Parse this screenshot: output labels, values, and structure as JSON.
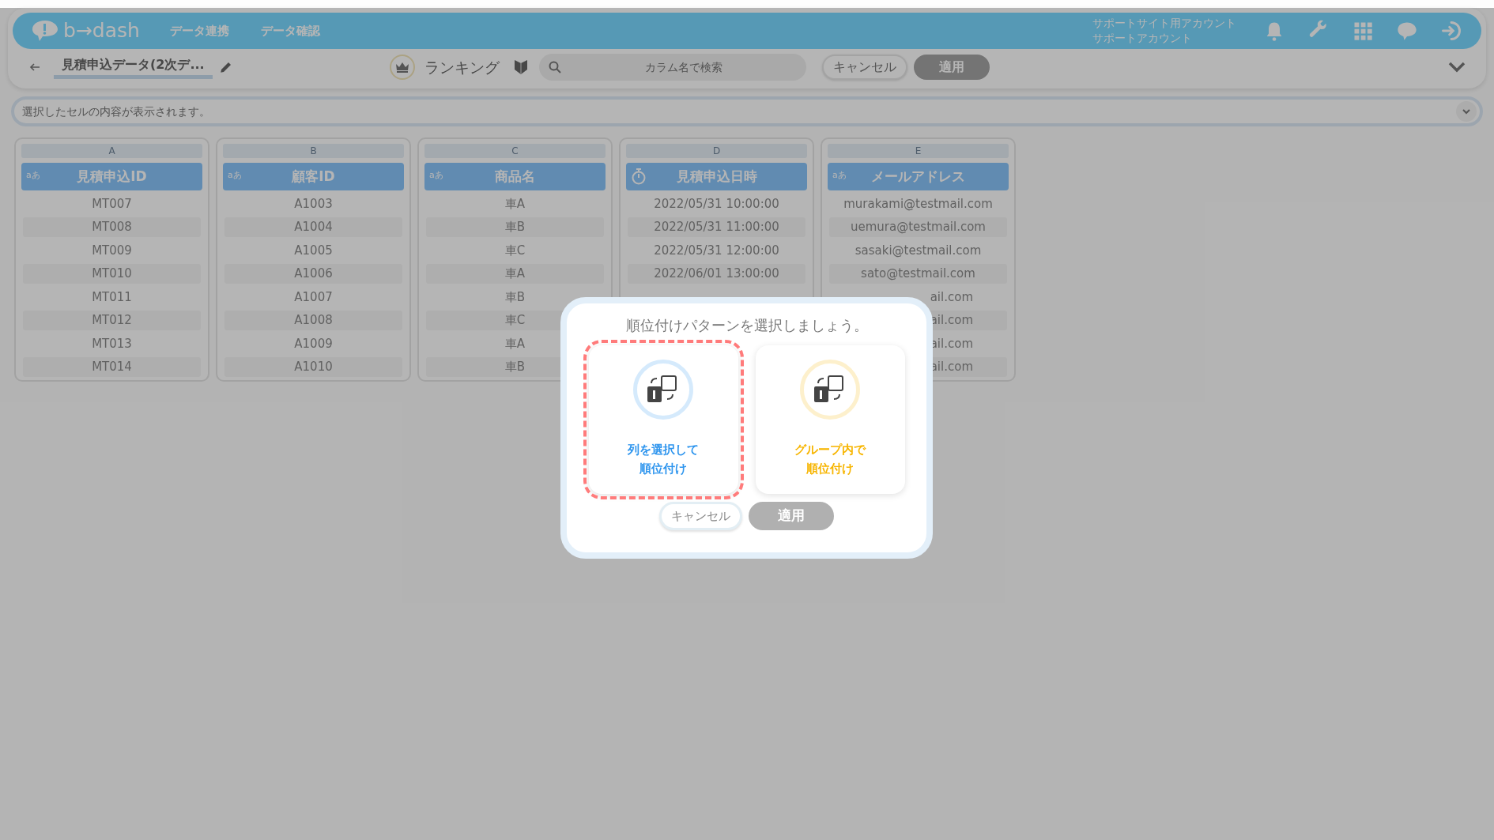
{
  "header": {
    "logo": "b→dash",
    "nav": [
      "データ連携",
      "データ確認"
    ],
    "account": {
      "site": "サポートサイト用アカウント",
      "name": "サポートアカウント"
    }
  },
  "toolbar": {
    "title": "見積申込データ(2次デ...",
    "mode": "ランキング",
    "search": {
      "placeholder": "カラム名で検索"
    },
    "buttons": [
      {
        "label": "キャンセル",
        "disabled": false
      },
      {
        "label": "適用",
        "disabled": true
      }
    ]
  },
  "cell_viewer": {
    "placeholder": "選択したセルの内容が表示されます。"
  },
  "table": {
    "columns": [
      {
        "letter": "A",
        "name": "見積申込ID",
        "kind": "text",
        "type_label": "aあ"
      },
      {
        "letter": "B",
        "name": "顧客ID",
        "kind": "text",
        "type_label": "aあ"
      },
      {
        "letter": "C",
        "name": "商品名",
        "kind": "text",
        "type_label": "aあ"
      },
      {
        "letter": "D",
        "name": "見積申込日時",
        "kind": "datetime"
      },
      {
        "letter": "E",
        "name": "メールアドレス",
        "kind": "text",
        "type_label": "aあ"
      }
    ],
    "rows": [
      [
        "MT007",
        "A1003",
        "車A",
        "2022/05/31 10:00:00",
        "murakami@testmail.com"
      ],
      [
        "MT008",
        "A1004",
        "車B",
        "2022/05/31 11:00:00",
        "uemura@testmail.com"
      ],
      [
        "MT009",
        "A1005",
        "車C",
        "2022/05/31 12:00:00",
        "sasaki@testmail.com"
      ],
      [
        "MT010",
        "A1006",
        "車A",
        "2022/06/01 13:00:00",
        "sato@testmail.com"
      ],
      [
        "MT011",
        "A1007",
        "車B",
        null,
        {
          "text": "ail.com",
          "clipped": true
        }
      ],
      [
        "MT012",
        "A1008",
        "車C",
        null,
        {
          "text": "ail.com",
          "clipped": true
        }
      ],
      [
        "MT013",
        "A1009",
        "車A",
        null,
        {
          "text": "ail.com",
          "clipped": true
        }
      ],
      [
        "MT014",
        "A1010",
        "車B",
        null,
        {
          "text": "ail.com",
          "clipped": true
        }
      ]
    ]
  },
  "modal": {
    "title": "順位付けパターンを選択しましょう。",
    "options": [
      {
        "label": "列を選択して順位付け",
        "selected": true,
        "color": "#2e95ee"
      },
      {
        "label": "グループ内で順位付け",
        "selected": false,
        "color": "#f7b500"
      }
    ],
    "buttons": [
      {
        "label": "キャンセル",
        "disabled": false
      },
      {
        "label": "適用",
        "disabled": true
      }
    ]
  }
}
